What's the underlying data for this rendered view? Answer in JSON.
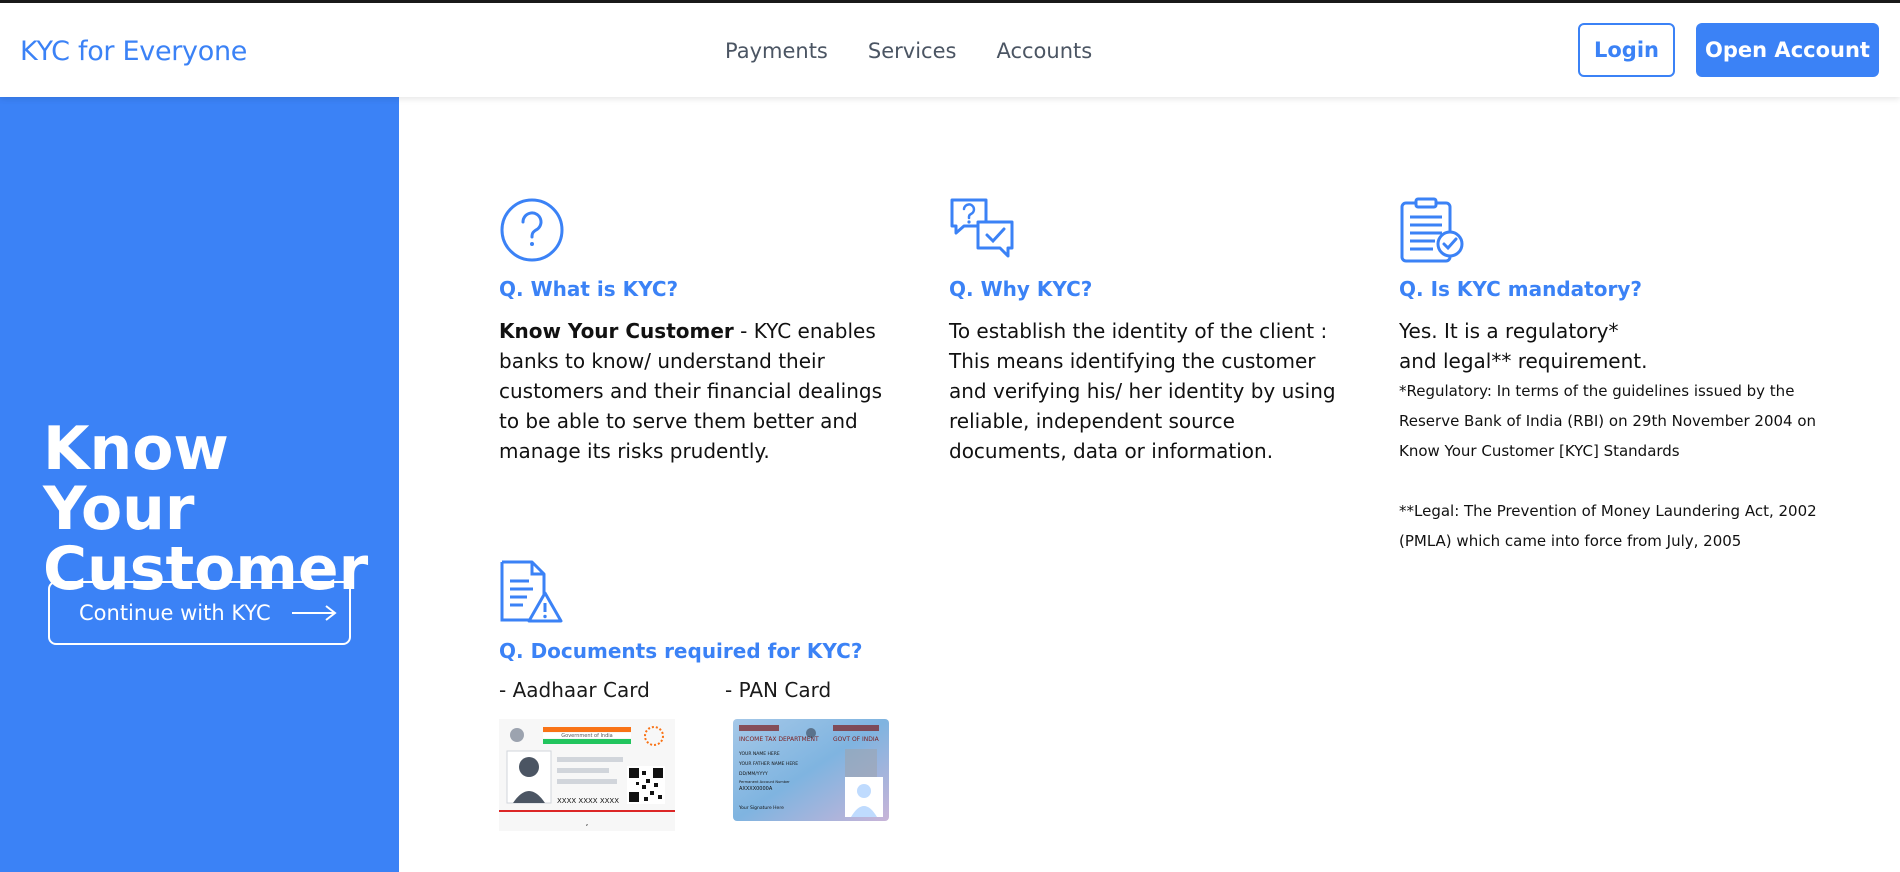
{
  "header": {
    "brand": "KYC for Everyone",
    "nav": [
      "Payments",
      "Services",
      "Accounts"
    ],
    "login_label": "Login",
    "open_account_label": "Open Account"
  },
  "hero": {
    "line1": "Know Your",
    "line2": "Customer",
    "cta_label": "Continue with KYC"
  },
  "faqs": [
    {
      "question": "Q. What is KYC?",
      "answer_bold": "Know Your Customer",
      "answer_rest": " - KYC enables banks to know/ understand their customers and their financial dealings to be able to serve them better and manage its risks prudently."
    },
    {
      "question": "Q. Why KYC?",
      "answer": "To establish the identity of the client : This means identifying the customer and verifying his/ her identity by using reliable, independent source documents, data or information."
    },
    {
      "question": "Q. Is KYC mandatory?",
      "answer_line1": "Yes. It is a regulatory*",
      "answer_line2": "and legal** requirement.",
      "note_regulatory": "*Regulatory: In terms of the guidelines issued by the Reserve Bank of India (RBI) on 29th November 2004 on Know Your Customer [KYC] Standards",
      "note_legal": "**Legal: The Prevention of Money Laundering Act, 2002 (PMLA) which came into force from July, 2005"
    },
    {
      "question": "Q. Documents required for KYC?",
      "doc1": "- Aadhaar Card",
      "doc2": "- PAN Card"
    }
  ],
  "aadhaar_card": {
    "number_mask": "XXXX XXXX XXXX",
    "header_text": "Government of India"
  },
  "pan_card": {
    "dept": "INCOME TAX DEPARTMENT",
    "govt": "GOVT OF INDIA",
    "name_field": "YOUR NAME HERE",
    "father_field": "YOUR FATHER NAME HERE",
    "dob": "DD/MM/YYYY",
    "pan_label": "Permanent Account Number",
    "pan_mask": "AXXXX0000A",
    "signature": "Your Signature Here"
  },
  "colors": {
    "accent": "#3b82f6"
  }
}
